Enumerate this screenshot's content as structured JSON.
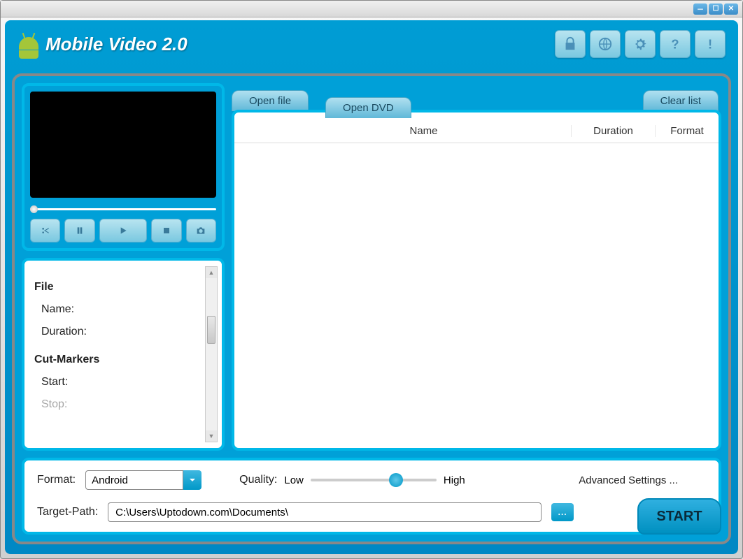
{
  "app": {
    "title": "Mobile Video 2.0"
  },
  "toolbar": {
    "open_file": "Open file",
    "open_dvd": "Open DVD",
    "clear_list": "Clear list"
  },
  "columns": {
    "name": "Name",
    "duration": "Duration",
    "format": "Format"
  },
  "info": {
    "file_hdg": "File",
    "name_lbl": "Name:",
    "duration_lbl": "Duration:",
    "cut_hdg": "Cut-Markers",
    "start_lbl": "Start:",
    "stop_lbl": "Stop:"
  },
  "bottom": {
    "format_lbl": "Format:",
    "format_value": "Android",
    "quality_lbl": "Quality:",
    "quality_low": "Low",
    "quality_high": "High",
    "advanced": "Advanced Settings ...",
    "target_lbl": "Target-Path:",
    "target_value": "C:\\Users\\Uptodown.com\\Documents\\",
    "browse": "...",
    "start": "START"
  }
}
